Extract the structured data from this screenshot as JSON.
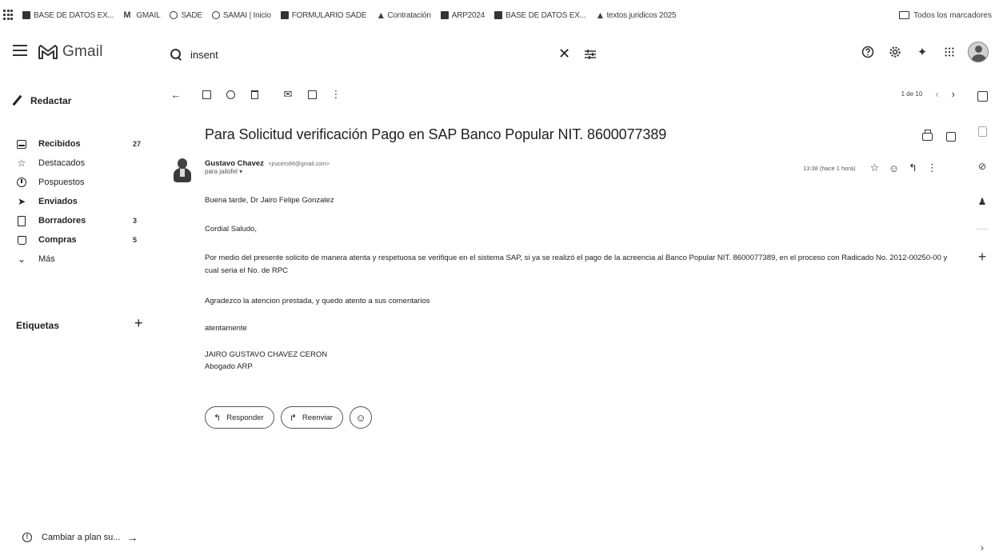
{
  "bookmarks": {
    "items": [
      {
        "label": "BASE DE DATOS EX...",
        "icon": "sheet-icon"
      },
      {
        "label": "GMAIL",
        "icon": "gmail-icon"
      },
      {
        "label": "SADE",
        "icon": "globe-icon"
      },
      {
        "label": "SAMAI | Inicio",
        "icon": "globe-icon"
      },
      {
        "label": "FORMULARIO SADE",
        "icon": "sheet-icon"
      },
      {
        "label": "Contratación",
        "icon": "drive-icon"
      },
      {
        "label": "ARP2024",
        "icon": "sheet-icon"
      },
      {
        "label": "BASE DE DATOS EX...",
        "icon": "sheet-icon"
      },
      {
        "label": "textos juridicos 2025",
        "icon": "drive-icon"
      }
    ],
    "all_bookmarks": "Todos los marcadores"
  },
  "header": {
    "app_name": "Gmail",
    "search_value": "insent"
  },
  "sidebar": {
    "compose_label": "Redactar",
    "items": [
      {
        "label": "Recibidos",
        "count": "27",
        "icon": "inbox-icon"
      },
      {
        "label": "Destacados",
        "count": "",
        "icon": "star-icon"
      },
      {
        "label": "Pospuestos",
        "count": "",
        "icon": "clock-icon"
      },
      {
        "label": "Enviados",
        "count": "",
        "icon": "send-icon"
      },
      {
        "label": "Borradores",
        "count": "3",
        "icon": "draft-icon"
      },
      {
        "label": "Compras",
        "count": "5",
        "icon": "shopping-icon"
      },
      {
        "label": "Más",
        "count": "",
        "icon": "chevron-down-icon"
      }
    ],
    "labels_title": "Etiquetas",
    "upgrade_label": "Cambiar a plan su..."
  },
  "toolbar": {
    "pager_text": "1 de 10"
  },
  "message": {
    "subject": "Para Solicitud verificación Pago en SAP Banco Popular NIT. 8600077389",
    "sender_name": "Gustavo Chavez",
    "sender_email": "<jrucero98@gmail.com>",
    "to_line": "para jailofel ▾",
    "time": "13:38 (hace 1 hora)",
    "body": [
      "Buena tarde, Dr Jairo Felipe Gonzalez",
      "Cordial Saludo,",
      "Por medio del presente solicito de manera atenta y respetuosa se verifique en el sistema SAP, si ya se realizó el pago de la acreencia al Banco Popular NIT. 8600077389, en el proceso con Radicado No. 2012-00250-00   y cual seria el No. de RPC",
      "Agradezco la atencion prestada, y quedo atento a sus comentarios",
      "atentamente",
      "JAIRO GUSTAVO CHAVEZ CERON",
      "Abogado ARP"
    ]
  },
  "actions": {
    "reply": "Responder",
    "forward": "Reenviar"
  }
}
